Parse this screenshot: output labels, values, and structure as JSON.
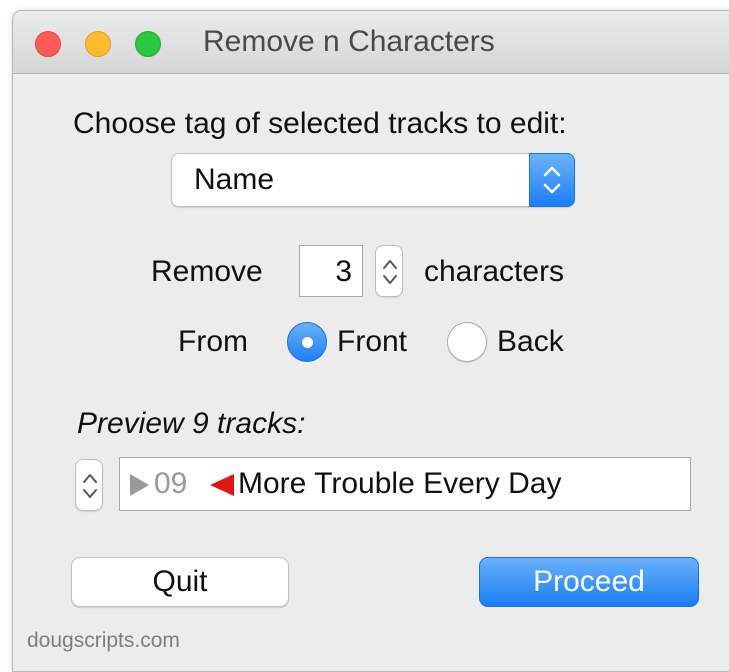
{
  "window": {
    "title": "Remove n Characters"
  },
  "tag_prompt": "Choose tag of selected tracks to edit:",
  "tag_popup": {
    "selected": "Name"
  },
  "remove_row": {
    "label_before": "Remove",
    "count": "3",
    "label_after": "characters"
  },
  "from_row": {
    "label": "From",
    "options": [
      {
        "label": "Front",
        "selected": true
      },
      {
        "label": "Back",
        "selected": false
      }
    ]
  },
  "preview": {
    "heading": "Preview 9 tracks:",
    "track_number": "09",
    "track_name": "More Trouble Every Day"
  },
  "buttons": {
    "quit": "Quit",
    "proceed": "Proceed"
  },
  "footer": "dougscripts.com",
  "colors": {
    "accent": "#1b7ef5",
    "cut_marker": "#e01515",
    "window_bg": "#ececec"
  }
}
